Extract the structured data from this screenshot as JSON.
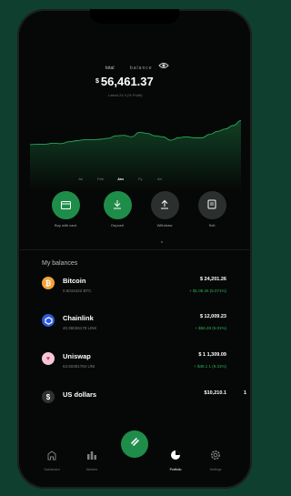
{
  "header": {
    "label": "total",
    "sublabel": "balance",
    "balance_currency": "$",
    "balance_value": "56,461.37",
    "balance_sub": "Latest 24 h (% Profit)"
  },
  "chart_data": {
    "type": "area",
    "series": [
      {
        "values": [
          39,
          40,
          40,
          42,
          41,
          45,
          47,
          49,
          49,
          50,
          52,
          57,
          58,
          55,
          64,
          62,
          57,
          55,
          48,
          53,
          55,
          53,
          53,
          60,
          66,
          71,
          78,
          88
        ]
      }
    ],
    "months": [
      "Jul",
      "Feb",
      "Jan",
      "Fy",
      "Ari"
    ],
    "active_month_index": 2,
    "color": "#27a85a",
    "grid": false
  },
  "actions": [
    {
      "label": "Buy with card",
      "icon": "card-icon",
      "style": "green"
    },
    {
      "label": "Deposit",
      "icon": "download-icon",
      "style": "green"
    },
    {
      "label": "Withdraw",
      "icon": "upload-icon",
      "style": "grey"
    },
    {
      "label": "Sell",
      "icon": "receipt-icon",
      "style": "grey"
    }
  ],
  "balances": {
    "title": "My balances",
    "items": [
      {
        "name": "Bitcoin",
        "amount": "0.6015422 BTC",
        "value": "$ 24,201.26",
        "change": "+ $1.08.26 (5.071%)",
        "icon": "bitcoin-icon",
        "color": "#f2a33a"
      },
      {
        "name": "Chainlink",
        "amount": "40.36026178 LINK",
        "value": "$ 12,009.23",
        "change": "+ $66.28 (6.01%)",
        "icon": "chainlink-icon",
        "color": "#2a5ada"
      },
      {
        "name": "Uniswap",
        "amount": "63.50381784 UNI",
        "value": "$ 1  1,309.09",
        "change": "+ $46.1   1 (9.31%)",
        "icon": "uniswap-icon",
        "color": "#f4c7d8"
      },
      {
        "name": "US dollars",
        "amount": "",
        "value": "$10,210.1",
        "change": "",
        "icon": "dollar-icon",
        "color": "#2e3231"
      }
    ],
    "trailing": "1"
  },
  "nav": [
    {
      "label": "Dashboard",
      "icon": "home-icon",
      "active": false
    },
    {
      "label": "Markets",
      "icon": "bar-chart-icon",
      "active": false
    },
    {
      "label": "",
      "icon": "swap-icon",
      "active": false
    },
    {
      "label": "Portfolio",
      "icon": "pie-chart-icon",
      "active": true
    },
    {
      "label": "Settings",
      "icon": "gear-icon",
      "active": false
    }
  ]
}
